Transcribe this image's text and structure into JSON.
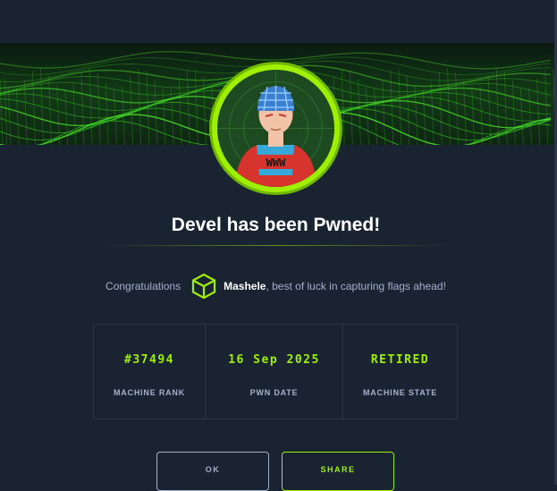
{
  "title": "Devel has been Pwned!",
  "congrats": {
    "prefix": "Congratulations",
    "username": "Mashele",
    "suffix": ", best of luck in capturing flags ahead!"
  },
  "stats": [
    {
      "value": "#37494",
      "label": "MACHINE RANK"
    },
    {
      "value": "16 Sep 2025",
      "label": "PWN DATE"
    },
    {
      "value": "RETIRED",
      "label": "MACHINE STATE"
    }
  ],
  "buttons": {
    "ok": "OK",
    "share": "SHARE"
  },
  "avatar": {
    "shirt_text": "WWW"
  },
  "colors": {
    "background": "#1a2332",
    "accent": "#9fef00",
    "muted_text": "#a4b1cd",
    "border": "#2a3547"
  },
  "icons": {
    "user_badge": "cube-icon"
  }
}
